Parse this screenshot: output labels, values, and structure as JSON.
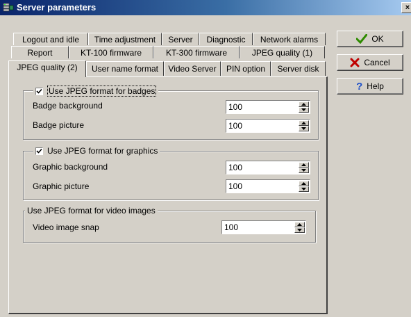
{
  "window": {
    "title": "Server parameters",
    "close_label": "×"
  },
  "tabs": {
    "row1": [
      "Logout and idle",
      "Time adjustment",
      "Server",
      "Diagnostic",
      "Network alarms"
    ],
    "row2": [
      "Report",
      "KT-100 firmware",
      "KT-300 firmware",
      "JPEG quality (1)"
    ],
    "row3": [
      "JPEG quality (2)",
      "User name format",
      "Video Server",
      "PIN option",
      "Server disk"
    ],
    "active": "JPEG quality (2)"
  },
  "badges": {
    "checkbox_label": "Use JPEG format for badges",
    "checked": true,
    "background_label": "Badge background",
    "background_value": "100",
    "picture_label": "Badge picture",
    "picture_value": "100"
  },
  "graphics": {
    "checkbox_label": "Use JPEG format for graphics",
    "checked": true,
    "background_label": "Graphic background",
    "background_value": "100",
    "picture_label": "Graphic picture",
    "picture_value": "100"
  },
  "video": {
    "group_label": "Use JPEG format for video images",
    "snap_label": "Video image snap",
    "snap_value": "100"
  },
  "buttons": {
    "ok": "OK",
    "cancel": "Cancel",
    "help": "Help"
  },
  "colors": {
    "titlebar_start": "#0a246a",
    "titlebar_end": "#a6caf0",
    "ok_icon": "#2e8b00",
    "cancel_icon": "#c00000",
    "help_icon": "#1e50c8"
  },
  "icons": {
    "app": "server-icon",
    "ok": "checkmark-icon",
    "cancel": "x-icon",
    "help": "question-icon"
  }
}
